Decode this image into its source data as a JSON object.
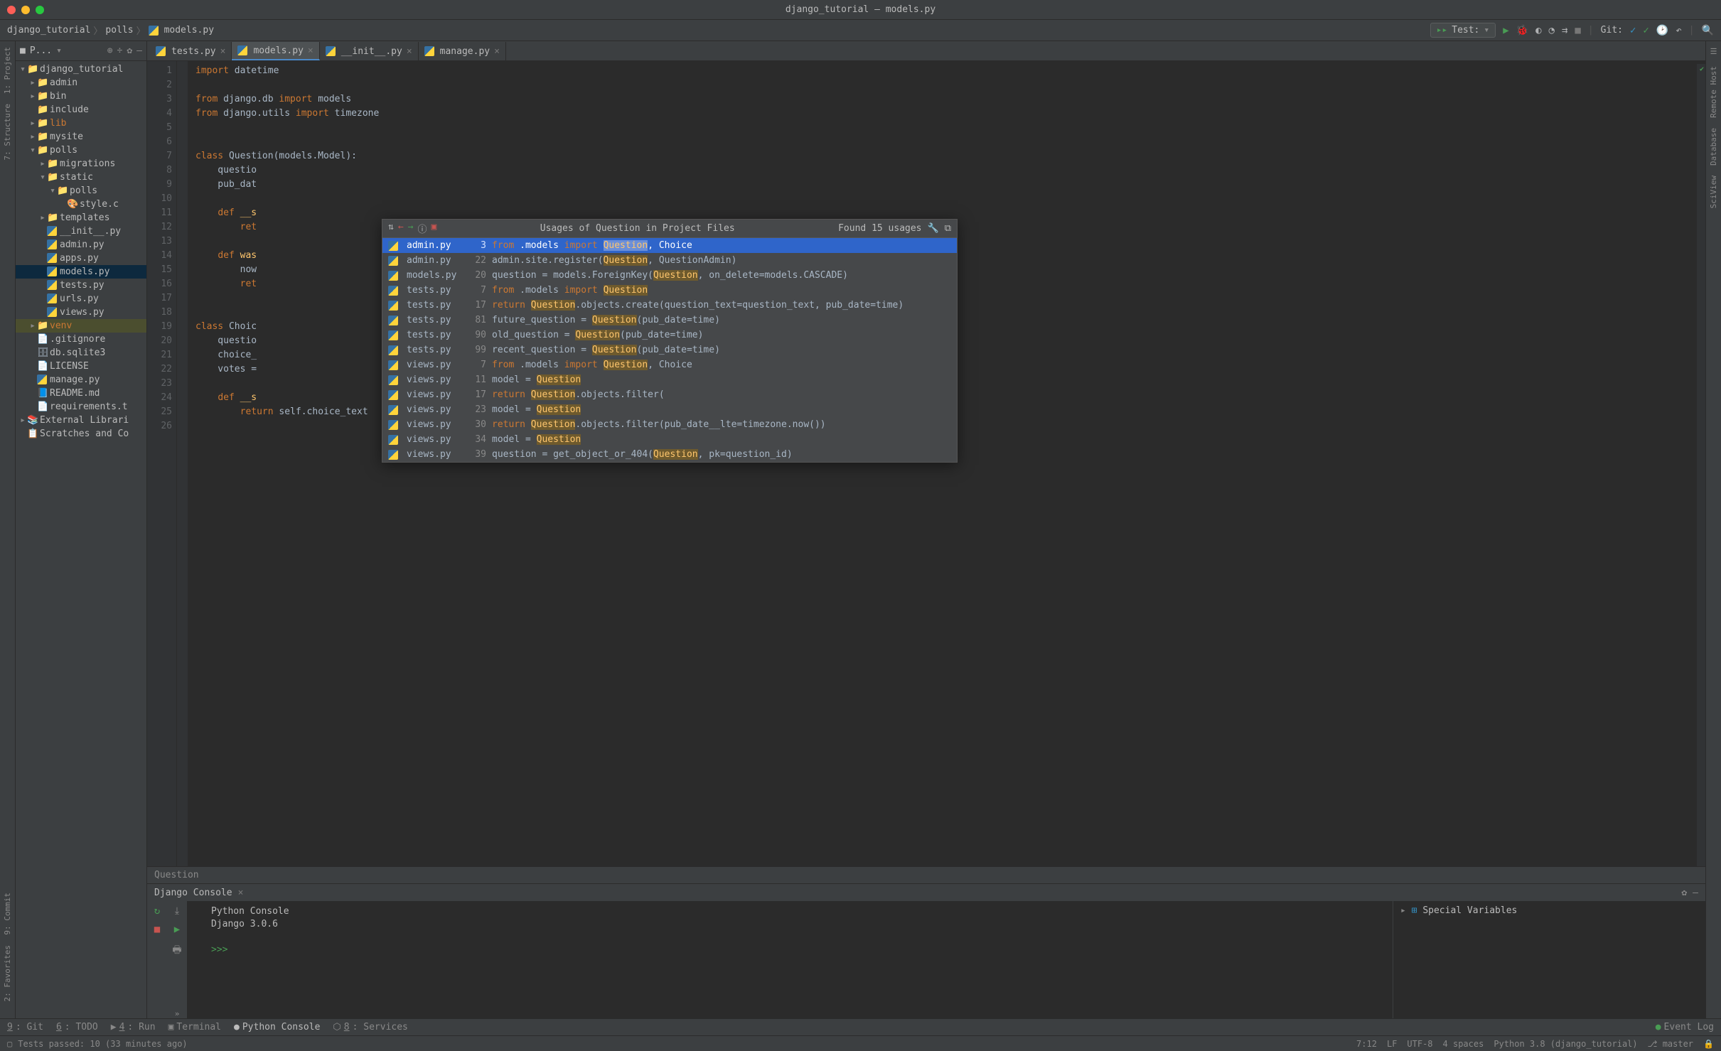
{
  "window_title": "django_tutorial – models.py",
  "breadcrumbs": [
    "django_tutorial",
    "polls",
    "models.py"
  ],
  "run_config": "Test:",
  "git_label": "Git:",
  "leftstrip": [
    "1: Project",
    "7: Structure",
    "9: Commit",
    "2: Favorites"
  ],
  "rightstrip": [
    "Remote Host",
    "Database",
    "SciView"
  ],
  "project": {
    "header": "P...",
    "tree": [
      {
        "d": 0,
        "t": "▾",
        "i": "dir",
        "l": "django_tutorial",
        "bold": true
      },
      {
        "d": 1,
        "t": "▸",
        "i": "dir",
        "l": "admin"
      },
      {
        "d": 1,
        "t": "▸",
        "i": "dir",
        "l": "bin"
      },
      {
        "d": 1,
        "t": "",
        "i": "dir",
        "l": "include"
      },
      {
        "d": 1,
        "t": "▸",
        "i": "dir",
        "l": "lib",
        "cls": "orange"
      },
      {
        "d": 1,
        "t": "▸",
        "i": "dir",
        "l": "mysite"
      },
      {
        "d": 1,
        "t": "▾",
        "i": "dir",
        "l": "polls"
      },
      {
        "d": 2,
        "t": "▸",
        "i": "dir",
        "l": "migrations"
      },
      {
        "d": 2,
        "t": "▾",
        "i": "dir",
        "l": "static"
      },
      {
        "d": 3,
        "t": "▾",
        "i": "dir",
        "l": "polls"
      },
      {
        "d": 4,
        "t": "",
        "i": "css",
        "l": "style.c"
      },
      {
        "d": 2,
        "t": "▸",
        "i": "dir",
        "l": "templates"
      },
      {
        "d": 2,
        "t": "",
        "i": "py",
        "l": "__init__.py"
      },
      {
        "d": 2,
        "t": "",
        "i": "py",
        "l": "admin.py"
      },
      {
        "d": 2,
        "t": "",
        "i": "py",
        "l": "apps.py"
      },
      {
        "d": 2,
        "t": "",
        "i": "py",
        "l": "models.py",
        "sel": true
      },
      {
        "d": 2,
        "t": "",
        "i": "py",
        "l": "tests.py"
      },
      {
        "d": 2,
        "t": "",
        "i": "py",
        "l": "urls.py"
      },
      {
        "d": 2,
        "t": "",
        "i": "py",
        "l": "views.py"
      },
      {
        "d": 1,
        "t": "▸",
        "i": "dir",
        "l": "venv",
        "cls": "orange",
        "hl": true
      },
      {
        "d": 1,
        "t": "",
        "i": "txt",
        "l": ".gitignore"
      },
      {
        "d": 1,
        "t": "",
        "i": "db",
        "l": "db.sqlite3"
      },
      {
        "d": 1,
        "t": "",
        "i": "txt",
        "l": "LICENSE"
      },
      {
        "d": 1,
        "t": "",
        "i": "py",
        "l": "manage.py"
      },
      {
        "d": 1,
        "t": "",
        "i": "md",
        "l": "README.md"
      },
      {
        "d": 1,
        "t": "",
        "i": "txt",
        "l": "requirements.t"
      },
      {
        "d": 0,
        "t": "▸",
        "i": "lib",
        "l": "External Librari"
      },
      {
        "d": 0,
        "t": "",
        "i": "scr",
        "l": "Scratches and Co"
      }
    ]
  },
  "tabs": [
    {
      "l": "tests.py"
    },
    {
      "l": "models.py",
      "active": true
    },
    {
      "l": "__init__.py"
    },
    {
      "l": "manage.py"
    }
  ],
  "lines": [
    1,
    2,
    3,
    4,
    5,
    6,
    7,
    8,
    9,
    10,
    11,
    12,
    13,
    14,
    15,
    16,
    17,
    18,
    19,
    20,
    21,
    22,
    23,
    24,
    25,
    26
  ],
  "code": [
    {
      "t": [
        [
          "kw",
          "import"
        ],
        [
          "id",
          " datetime"
        ]
      ]
    },
    {
      "t": []
    },
    {
      "t": [
        [
          "kw",
          "from"
        ],
        [
          "id",
          " django.db "
        ],
        [
          "kw",
          "import"
        ],
        [
          "id",
          " models"
        ]
      ]
    },
    {
      "t": [
        [
          "kw",
          "from"
        ],
        [
          "id",
          " django.utils "
        ],
        [
          "kw",
          "import"
        ],
        [
          "id",
          " timezone"
        ]
      ]
    },
    {
      "t": []
    },
    {
      "t": []
    },
    {
      "t": [
        [
          "kw",
          "class "
        ],
        [
          "cls",
          "Question"
        ],
        [
          "id",
          "(models.Model):"
        ]
      ]
    },
    {
      "t": [
        [
          "id",
          "    questio"
        ]
      ]
    },
    {
      "t": [
        [
          "id",
          "    pub_dat"
        ]
      ]
    },
    {
      "t": []
    },
    {
      "t": [
        [
          "id",
          "    "
        ],
        [
          "kw",
          "def "
        ],
        [
          "fn",
          "__s"
        ]
      ]
    },
    {
      "t": [
        [
          "id",
          "        "
        ],
        [
          "kw",
          "ret"
        ]
      ]
    },
    {
      "t": []
    },
    {
      "t": [
        [
          "id",
          "    "
        ],
        [
          "kw",
          "def "
        ],
        [
          "fn",
          "was"
        ]
      ]
    },
    {
      "t": [
        [
          "id",
          "        now"
        ]
      ]
    },
    {
      "t": [
        [
          "id",
          "        "
        ],
        [
          "kw",
          "ret"
        ]
      ]
    },
    {
      "t": []
    },
    {
      "t": []
    },
    {
      "t": [
        [
          "kw",
          "class "
        ],
        [
          "cls",
          "Choic"
        ]
      ]
    },
    {
      "t": [
        [
          "id",
          "    questio"
        ]
      ]
    },
    {
      "t": [
        [
          "id",
          "    choice_"
        ]
      ]
    },
    {
      "t": [
        [
          "id",
          "    votes = "
        ]
      ]
    },
    {
      "t": []
    },
    {
      "t": [
        [
          "id",
          "    "
        ],
        [
          "kw",
          "def "
        ],
        [
          "fn",
          "__s"
        ]
      ]
    },
    {
      "t": [
        [
          "id",
          "        "
        ],
        [
          "kw",
          "return "
        ],
        [
          "id",
          "self.choice_text"
        ]
      ]
    },
    {
      "t": []
    }
  ],
  "crumb_bottom": "Question",
  "popup": {
    "title": "Usages of Question in Project Files",
    "found": "Found 15 usages",
    "rows": [
      {
        "f": "admin.py",
        "n": 3,
        "sel": true,
        "s": [
          [
            "skw",
            "from"
          ],
          [
            "",
            " .models "
          ],
          [
            "skw",
            "import"
          ],
          [
            "",
            " "
          ],
          [
            "m",
            "Question"
          ],
          [
            "",
            ", Choice"
          ]
        ]
      },
      {
        "f": "admin.py",
        "n": 22,
        "s": [
          [
            "",
            "admin.site.register("
          ],
          [
            "m",
            "Question"
          ],
          [
            "",
            ", QuestionAdmin)"
          ]
        ]
      },
      {
        "f": "models.py",
        "n": 20,
        "s": [
          [
            "",
            "question = models.ForeignKey("
          ],
          [
            "m",
            "Question"
          ],
          [
            "",
            ", on_delete=models.CASCADE)"
          ]
        ]
      },
      {
        "f": "tests.py",
        "n": 7,
        "s": [
          [
            "skw",
            "from"
          ],
          [
            "",
            " .models "
          ],
          [
            "skw",
            "import"
          ],
          [
            "",
            " "
          ],
          [
            "m",
            "Question"
          ]
        ]
      },
      {
        "f": "tests.py",
        "n": 17,
        "s": [
          [
            "skw",
            "return"
          ],
          [
            "",
            " "
          ],
          [
            "m",
            "Question"
          ],
          [
            "",
            ".objects.create(question_text=question_text, pub_date=time)"
          ]
        ]
      },
      {
        "f": "tests.py",
        "n": 81,
        "s": [
          [
            "",
            "future_question = "
          ],
          [
            "m",
            "Question"
          ],
          [
            "",
            "(pub_date=time)"
          ]
        ]
      },
      {
        "f": "tests.py",
        "n": 90,
        "s": [
          [
            "",
            "old_question = "
          ],
          [
            "m",
            "Question"
          ],
          [
            "",
            "(pub_date=time)"
          ]
        ]
      },
      {
        "f": "tests.py",
        "n": 99,
        "s": [
          [
            "",
            "recent_question = "
          ],
          [
            "m",
            "Question"
          ],
          [
            "",
            "(pub_date=time)"
          ]
        ]
      },
      {
        "f": "views.py",
        "n": 7,
        "s": [
          [
            "skw",
            "from"
          ],
          [
            "",
            " .models "
          ],
          [
            "skw",
            "import"
          ],
          [
            "",
            " "
          ],
          [
            "m",
            "Question"
          ],
          [
            "",
            ", Choice"
          ]
        ]
      },
      {
        "f": "views.py",
        "n": 11,
        "s": [
          [
            "",
            "model = "
          ],
          [
            "m",
            "Question"
          ]
        ]
      },
      {
        "f": "views.py",
        "n": 17,
        "s": [
          [
            "skw",
            "return"
          ],
          [
            "",
            " "
          ],
          [
            "m",
            "Question"
          ],
          [
            "",
            ".objects.filter("
          ]
        ]
      },
      {
        "f": "views.py",
        "n": 23,
        "s": [
          [
            "",
            "model = "
          ],
          [
            "m",
            "Question"
          ]
        ]
      },
      {
        "f": "views.py",
        "n": 30,
        "s": [
          [
            "skw",
            "return"
          ],
          [
            "",
            " "
          ],
          [
            "m",
            "Question"
          ],
          [
            "",
            ".objects.filter(pub_date__lte=timezone.now())"
          ]
        ]
      },
      {
        "f": "views.py",
        "n": 34,
        "s": [
          [
            "",
            "model = "
          ],
          [
            "m",
            "Question"
          ]
        ]
      },
      {
        "f": "views.py",
        "n": 39,
        "s": [
          [
            "",
            "question = get_object_or_404("
          ],
          [
            "m",
            "Question"
          ],
          [
            "",
            ", pk=question_id)"
          ]
        ]
      }
    ]
  },
  "console": {
    "tab": "Django Console",
    "lines": [
      "Python Console",
      "Django 3.0.6"
    ],
    "prompt": ">>>",
    "vars": "Special Variables"
  },
  "tools": [
    {
      "k": "9",
      "l": "Git"
    },
    {
      "k": "6",
      "l": "TODO"
    },
    {
      "k": "4",
      "l": "Run",
      "icon": "▶"
    },
    {
      "k": "",
      "l": "Terminal",
      "icon": "▣"
    },
    {
      "k": "",
      "l": "Python Console",
      "icon": "●",
      "active": true
    },
    {
      "k": "8",
      "l": "Services",
      "icon": "⬡"
    }
  ],
  "event_log": "Event Log",
  "status": {
    "left": "Tests passed: 10 (33 minutes ago)",
    "pos": "7:12",
    "lf": "LF",
    "enc": "UTF-8",
    "indent": "4 spaces",
    "sdk": "Python 3.8 (django_tutorial)",
    "branch": "master"
  }
}
